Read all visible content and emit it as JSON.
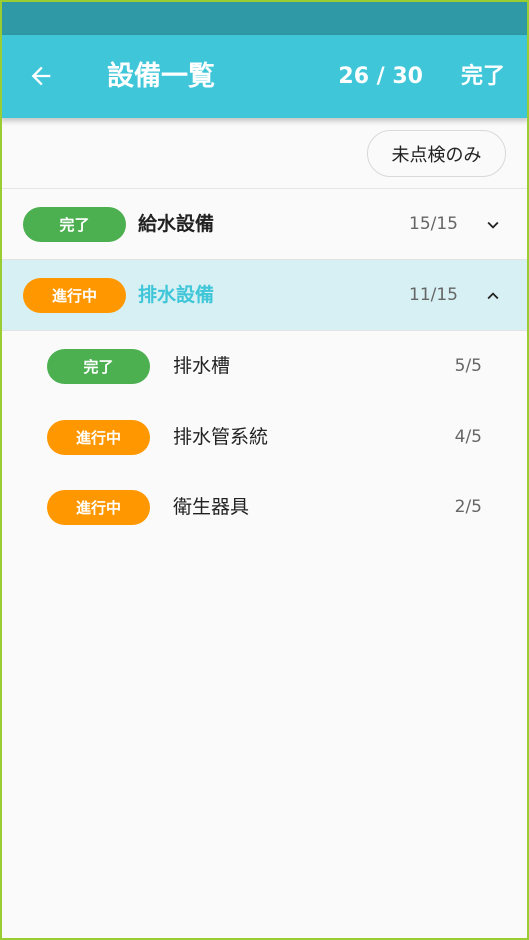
{
  "colors": {
    "status_bar": "#2f9aa6",
    "app_bar": "#3fc6d8",
    "done": "#4caf50",
    "in_progress": "#ff9800",
    "expanded_row": "#d7f0f3",
    "frame": "#9acd32"
  },
  "header": {
    "back_icon": "arrow-left-icon",
    "title": "設備一覧",
    "counter": "26 / 30",
    "done_label": "完了"
  },
  "filter": {
    "label": "未点検のみ"
  },
  "categories": [
    {
      "status": "完了",
      "status_color": "green",
      "name": "給水設備",
      "count": "15/15",
      "expanded": false,
      "chevron_icon": "chevron-down-icon"
    },
    {
      "status": "進行中",
      "status_color": "orange",
      "name": "排水設備",
      "count": "11/15",
      "expanded": true,
      "chevron_icon": "chevron-up-icon"
    }
  ],
  "sub_items": [
    {
      "status": "完了",
      "status_color": "green",
      "name": "排水槽",
      "count": "5/5"
    },
    {
      "status": "進行中",
      "status_color": "orange",
      "name": "排水管系統",
      "count": "4/5"
    },
    {
      "status": "進行中",
      "status_color": "orange",
      "name": "衛生器具",
      "count": "2/5"
    }
  ]
}
